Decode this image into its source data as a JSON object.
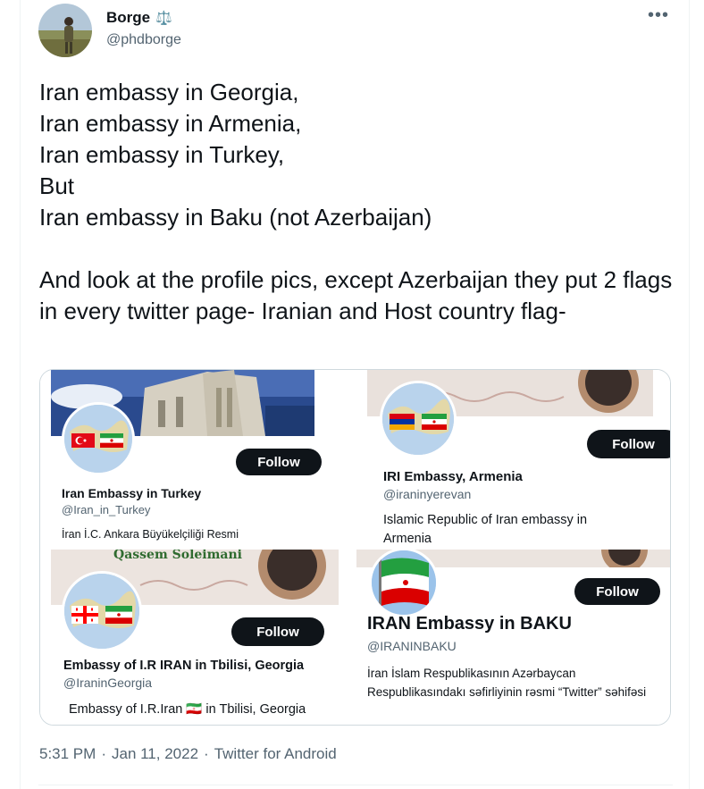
{
  "author": {
    "display_name": "Borge",
    "badge": "⚖️",
    "handle": "@phdborge"
  },
  "more_icon": "•••",
  "tweet_text": "Iran embassy in Georgia,\nIran embassy in Armenia,\nIran embassy in Turkey,\nBut\nIran embassy in Baku (not Azerbaijan)\n\nAnd look at the profile pics, except Azerbaijan they put 2 flags in every twitter page- Iranian and Host country flag-",
  "media": {
    "profiles": [
      {
        "name": "Iran Embassy in Turkey",
        "handle": "@Iran_in_Turkey",
        "bio": "İran İ.C. Ankara Büyükelçiliği Resmi",
        "follow_label": "Follow",
        "flags": [
          "turkey",
          "iran"
        ]
      },
      {
        "name": "IRI Embassy, Armenia",
        "handle": "@iraninyerevan",
        "bio": "Islamic Republic of Iran embassy in Armenia",
        "follow_label": "Follow",
        "flags": [
          "armenia",
          "iran"
        ]
      },
      {
        "name": "Embassy of I.R IRAN in Tbilisi, Georgia",
        "handle": "@IraninGeorgia",
        "bio": "Embassy of I.R.Iran 🇮🇷 in Tbilisi, Georgia",
        "banner_text": "Qassem Soleimani",
        "follow_label": "Follow",
        "flags": [
          "georgia",
          "iran"
        ]
      },
      {
        "name": "IRAN Embassy in BAKU",
        "handle": "@IRANINBAKU",
        "bio": "İran İslam Respublikasının Azərbaycan Respublikasındakı səfirliyinin rəsmi  “Twitter” səhifəsi",
        "follow_label": "Follow",
        "flags": [
          "iran"
        ]
      }
    ]
  },
  "meta": {
    "time": "5:31 PM",
    "sep1": "·",
    "date": "Jan 11, 2022",
    "sep2": "·",
    "source": "Twitter for Android"
  },
  "colors": {
    "text": "#0f1419",
    "muted": "#536471",
    "border": "#cfd9de",
    "iran_green": "#239f40",
    "iran_red": "#da0000",
    "turkey_red": "#e30a17",
    "armenia_red": "#d90012",
    "armenia_blue": "#0033a0",
    "armenia_orange": "#f2a800"
  }
}
